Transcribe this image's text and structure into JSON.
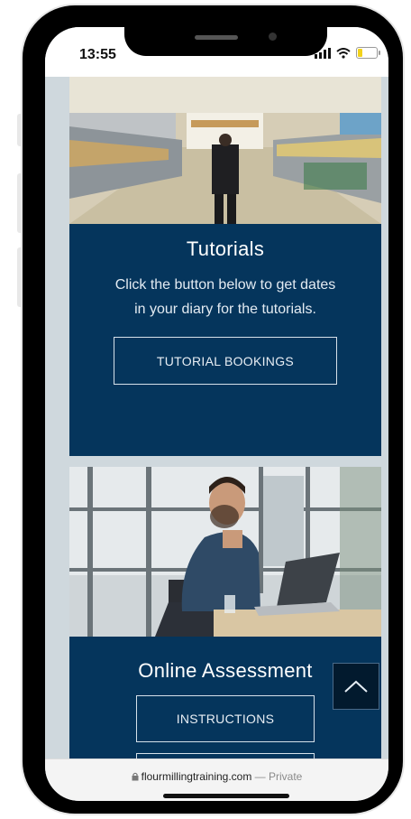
{
  "status": {
    "time": "13:55"
  },
  "tutorials": {
    "title": "Tutorials",
    "text": "Click the button below to get dates in your diary for the tutorials.",
    "button_label": "TUTORIAL BOOKINGS"
  },
  "assessment": {
    "title": "Online Assessment",
    "button_label": "INSTRUCTIONS"
  },
  "browser": {
    "domain": "flourmillingtraining.com",
    "suffix": " — Private"
  },
  "icons": {
    "scroll_top": "chevron-up-icon",
    "lock": "lock-icon"
  }
}
